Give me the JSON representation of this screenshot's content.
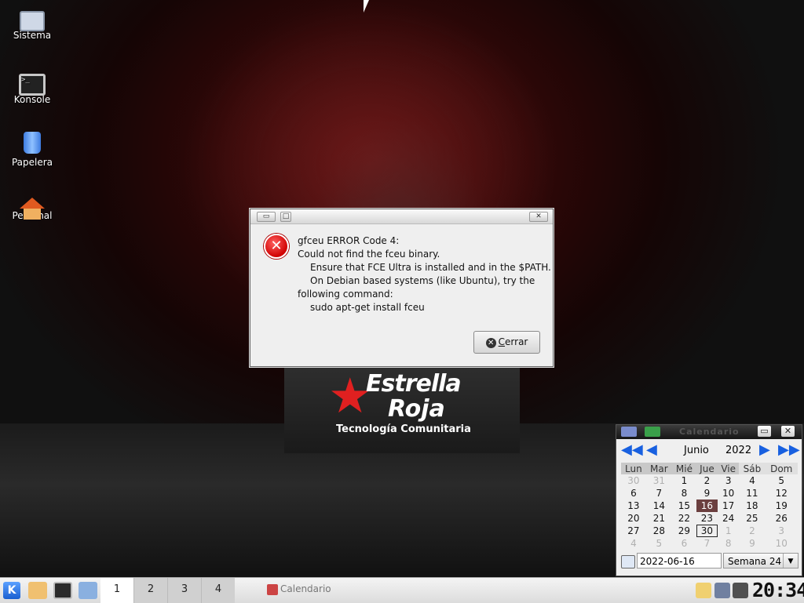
{
  "desktop": {
    "icons": [
      {
        "label": "Sistema",
        "icon": "computer-icon"
      },
      {
        "label": "Konsole",
        "icon": "terminal-icon"
      },
      {
        "label": "Papelera",
        "icon": "trash-icon"
      },
      {
        "label": "Personal",
        "icon": "home-folder-icon"
      }
    ],
    "brand": {
      "line1": "Estrella",
      "line2": "Roja",
      "tagline": "Tecnología Comunitaria"
    }
  },
  "dialog": {
    "lines": [
      "gfceu ERROR Code 4:",
      "Could not find the fceu binary.",
      "Ensure that FCE Ultra is installed and in the $PATH.",
      "On Debian based systems (like Ubuntu), try the",
      "following command:",
      "sudo apt-get install fceu"
    ],
    "close_button": {
      "prefix": "",
      "label_underlined": "C",
      "label_rest": "errar"
    }
  },
  "calendar": {
    "title": "Calendario",
    "month": "Junio",
    "year": "2022",
    "weekdays": [
      "Lun",
      "Mar",
      "Mié",
      "Jue",
      "Vie",
      "Sáb",
      "Dom"
    ],
    "weeks": [
      [
        "30",
        "31",
        "1",
        "2",
        "3",
        "4",
        "5"
      ],
      [
        "6",
        "7",
        "8",
        "9",
        "10",
        "11",
        "12"
      ],
      [
        "13",
        "14",
        "15",
        "16",
        "17",
        "18",
        "19"
      ],
      [
        "20",
        "21",
        "22",
        "23",
        "24",
        "25",
        "26"
      ],
      [
        "27",
        "28",
        "29",
        "30",
        "1",
        "2",
        "3"
      ],
      [
        "4",
        "5",
        "6",
        "7",
        "8",
        "9",
        "10"
      ]
    ],
    "date_value": "2022-06-16",
    "week_value": "Semana 24",
    "today": "16",
    "selected": "30"
  },
  "taskbar": {
    "desktops": [
      "1",
      "2",
      "3",
      "4"
    ],
    "task_label": "Calendario",
    "clock": "20:34"
  }
}
